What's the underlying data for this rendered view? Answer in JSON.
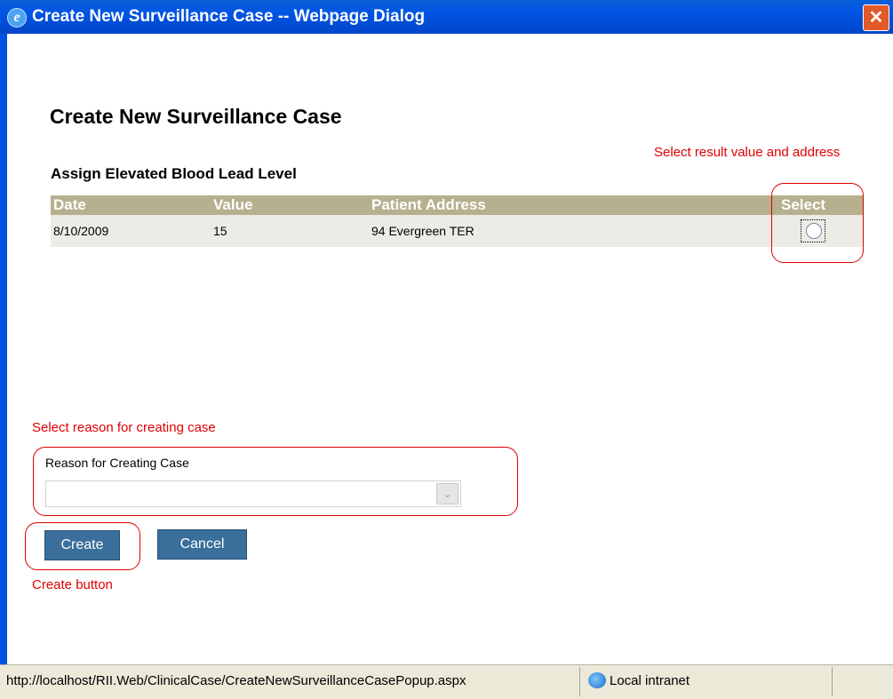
{
  "window": {
    "title": "Create New Surveillance Case -- Webpage Dialog",
    "close_glyph": "✕",
    "app_icon": "e"
  },
  "page": {
    "heading": "Create New Surveillance Case",
    "subheading": "Assign Elevated Blood Lead Level"
  },
  "annotations": {
    "select_result": "Select result value and address",
    "select_reason": "Select reason for creating case",
    "create_button": "Create button"
  },
  "table": {
    "columns": [
      "Date",
      "Value",
      "Patient Address",
      "Select"
    ],
    "rows": [
      {
        "date": "8/10/2009",
        "value": "15",
        "address": "94 Evergreen TER",
        "selected": false
      }
    ]
  },
  "form": {
    "reason_label": "Reason for Creating Case",
    "reason_value": "",
    "dropdown_icon": "chevron-down-icon"
  },
  "buttons": {
    "create": "Create",
    "cancel": "Cancel"
  },
  "status": {
    "url": "http://localhost/RII.Web/ClinicalCase/CreateNewSurveillanceCasePopup.aspx",
    "zone": "Local intranet"
  },
  "colors": {
    "annotation": "#e00000",
    "table_header": "#b6b08f",
    "button": "#3a6e9b",
    "titlebar": "#0054e3"
  }
}
